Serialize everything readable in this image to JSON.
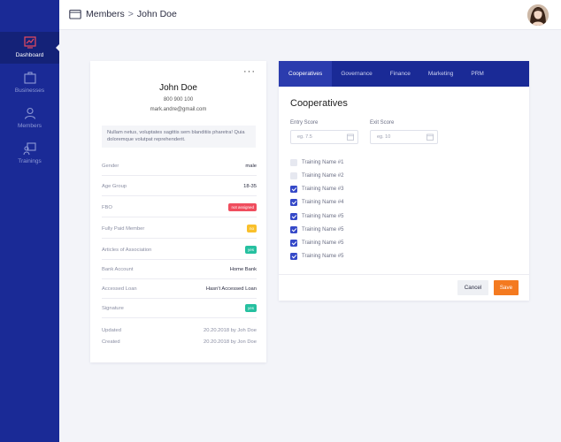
{
  "breadcrumb": {
    "section": "Members",
    "separator": ">",
    "current": "John Doe"
  },
  "sidebar": {
    "items": [
      {
        "label": "Dashboard",
        "icon": "dashboard-chart-icon",
        "active": true
      },
      {
        "label": "Businesses",
        "icon": "briefcase-icon",
        "active": false
      },
      {
        "label": "Members",
        "icon": "user-icon",
        "active": false
      },
      {
        "label": "Trainings",
        "icon": "training-icon",
        "active": false
      }
    ]
  },
  "profile": {
    "more": "···",
    "name": "John Doe",
    "phone": "800 900 100",
    "email": "mark.andre@gmail.com",
    "bio": "Nullam netus, voluptates sagittis sem blanditiis pharetra! Quia doloremque volutpat reprehenderit.",
    "fields": [
      {
        "label": "Gender",
        "value": "male"
      },
      {
        "label": "Age Group",
        "value": "18-35"
      },
      {
        "label": "FBO",
        "badge": "not assigned",
        "badge_color": "#f04d5e"
      },
      {
        "label": "Fully Paid Member",
        "badge": "no",
        "badge_color": "#f9c02b"
      },
      {
        "label": "Articles of Association",
        "badge": "yes",
        "badge_color": "#26c0a0"
      },
      {
        "label": "Bank Account",
        "value": "Home Bank"
      },
      {
        "label": "Accessed Loan",
        "value": "Hasn't Accessed Loan"
      },
      {
        "label": "Signature",
        "badge": "yes",
        "badge_color": "#26c0a0"
      }
    ],
    "updated_label": "Updated",
    "updated_value": "20.20.2018 by Joh Doe",
    "created_label": "Created",
    "created_value": "20.20.2018 by Jon Doe"
  },
  "coop": {
    "tabs": [
      "Cooperatives",
      "Governance",
      "Finance",
      "Marketing",
      "PRM"
    ],
    "active_tab": 0,
    "title": "Cooperatives",
    "entry_label": "Entry Score",
    "entry_placeholder": "eg. 7.5",
    "exit_label": "Exit Score",
    "exit_placeholder": "eg. 10",
    "trainings": [
      {
        "label": "Training Name #1",
        "checked": false
      },
      {
        "label": "Training Name #2",
        "checked": false
      },
      {
        "label": "Training Name #3",
        "checked": true
      },
      {
        "label": "Training Name #4",
        "checked": true
      },
      {
        "label": "Training Name #5",
        "checked": true
      },
      {
        "label": "Training Name #5",
        "checked": true
      },
      {
        "label": "Training Name #5",
        "checked": true
      },
      {
        "label": "Training Name #5",
        "checked": true
      }
    ],
    "cancel_label": "Cancel",
    "save_label": "Save"
  },
  "colors": {
    "sidebar": "#1a2a96",
    "accent": "#3549c8",
    "save": "#f47a20"
  }
}
